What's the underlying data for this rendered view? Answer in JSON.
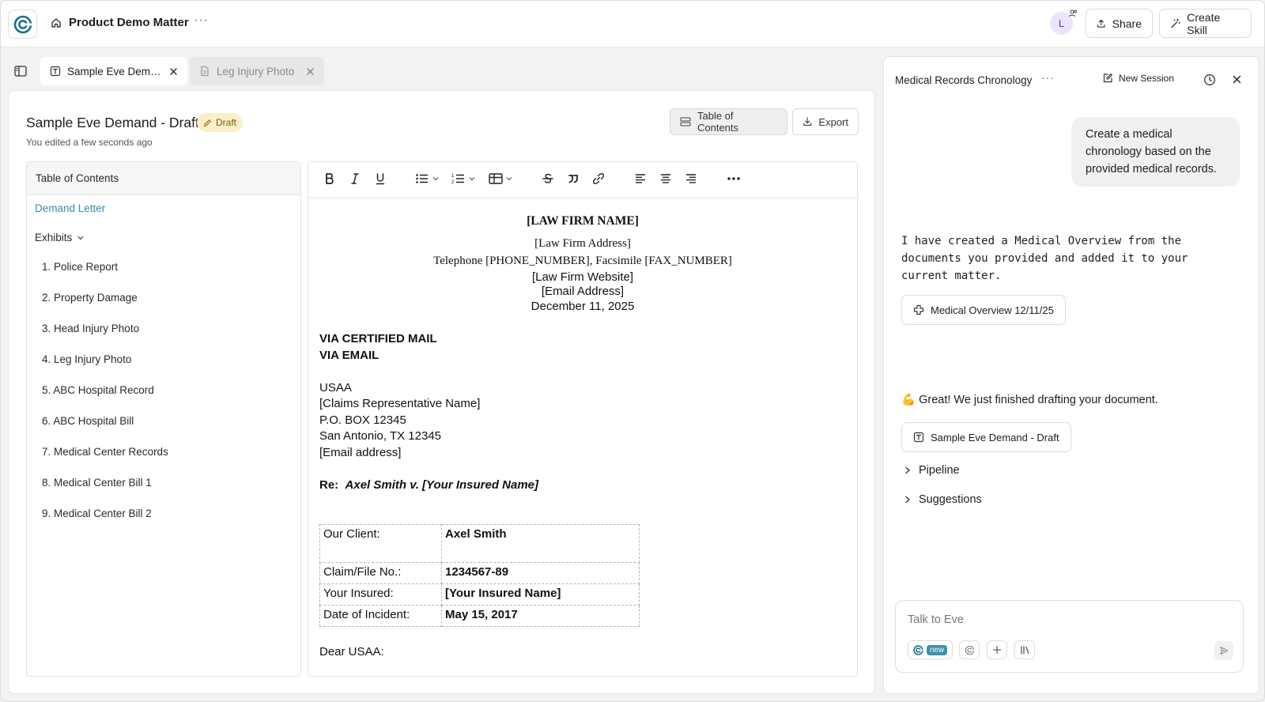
{
  "header": {
    "matter_title": "Product Demo Matter",
    "more": "···",
    "avatar_initial": "L",
    "share_label": "Share",
    "create_skill_label": "Create Skill"
  },
  "tabs": [
    {
      "label": "Sample Eve Demand - Draft",
      "active": true
    },
    {
      "label": "Leg Injury Photo",
      "active": false
    }
  ],
  "document": {
    "title": "Sample Eve Demand - Draft",
    "badge": "Draft",
    "edited": "You edited a few seconds ago",
    "toc_button": "Table of Contents",
    "export_button": "Export"
  },
  "toc": {
    "heading": "Table of Contents",
    "demand_letter": "Demand Letter",
    "exhibits_label": "Exhibits",
    "exhibits": [
      "1. Police Report",
      "2. Property Damage",
      "3. Head Injury Photo",
      "4. Leg Injury Photo",
      "5. ABC Hospital Record",
      "6. ABC Hospital Bill",
      "7. Medical Center Records",
      "8. Medical Center Bill 1",
      "9. Medical Center Bill 2"
    ]
  },
  "letter": {
    "firm_name": "[LAW FIRM NAME]",
    "firm_address": "[Law Firm Address]",
    "phone_fax": "Telephone [PHONE_NUMBER], Facsimile [FAX_NUMBER]",
    "website": "[Law Firm Website]",
    "email": "[Email Address]",
    "date": "December 11, 2025",
    "via1": "VIA CERTIFIED MAIL",
    "via2": "VIA EMAIL",
    "recipient": [
      "USAA",
      "[Claims Representative Name]",
      "P.O. BOX 12345",
      "San Antonio, TX 12345",
      "[Email address]"
    ],
    "re_label": "Re:",
    "re_text": "Axel Smith v. [Your Insured Name]",
    "table": [
      {
        "label": "Our Client:",
        "value": "Axel Smith"
      },
      {
        "label": "Claim/File No.:",
        "value": "1234567-89"
      },
      {
        "label": "Your Insured:",
        "value": "[Your Insured Name]"
      },
      {
        "label": "Date of Incident:",
        "value": "May 15, 2017"
      }
    ],
    "salutation": "Dear USAA:"
  },
  "chat": {
    "title": "Medical Records Chronology",
    "more": "···",
    "new_session": "New Session",
    "user_message": "Create a medical chronology based on the provided medical records.",
    "ai_message": "I have created a Medical Overview from the documents you provided and added it to your current matter.",
    "artifact1": "Medical Overview 12/11/25",
    "done_message": "💪 Great! We just finished drafting your document.",
    "artifact2": "Sample Eve Demand - Draft",
    "pipeline": "Pipeline",
    "suggestions": "Suggestions",
    "composer_placeholder": "Talk to Eve",
    "new_tag": "new"
  },
  "colors": {
    "accent": "#3a90ad",
    "draft_badge_bg": "#fbefc8",
    "link": "#3b89a8"
  }
}
